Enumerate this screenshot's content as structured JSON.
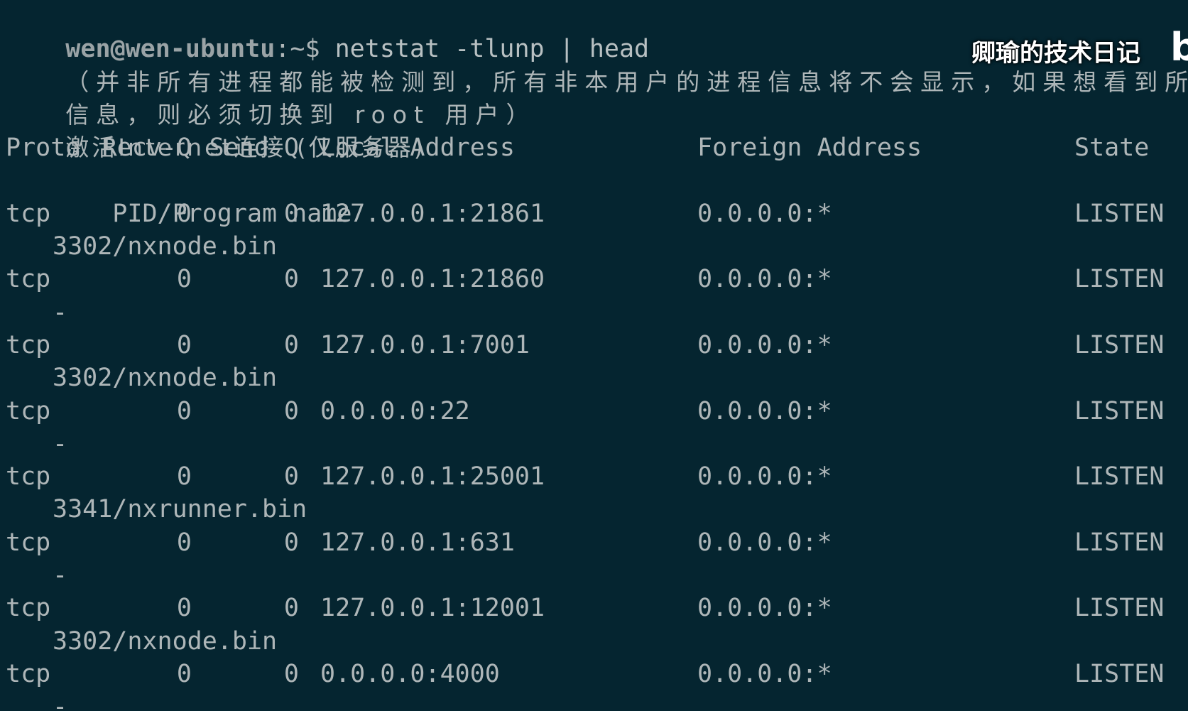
{
  "prompt": {
    "user_host": "wen@wen-ubuntu",
    "path": ":~$",
    "command": "netstat -tlunp | head"
  },
  "notice": {
    "line1": "（并非所有进程都能被检测到，所有非本用户的进程信息将不会显示，如果想看到所有",
    "line2": "信息，则必须切换到 root 用户）"
  },
  "section_title": "激活Internet连接 (仅服务器)",
  "headers": {
    "proto": "Proto",
    "recv_q": "Recv-Q",
    "send_q": "Send-Q",
    "local": "Local Address",
    "foreign": "Foreign Address",
    "state": "State",
    "pid_program": "PID/Program name"
  },
  "rows": [
    {
      "proto": "tcp",
      "recv_q": "0",
      "send_q": "0",
      "local": "127.0.0.1:21861",
      "foreign": "0.0.0.0:*",
      "state": "LISTEN",
      "pid_program": "3302/nxnode.bin"
    },
    {
      "proto": "tcp",
      "recv_q": "0",
      "send_q": "0",
      "local": "127.0.0.1:21860",
      "foreign": "0.0.0.0:*",
      "state": "LISTEN",
      "pid_program": "-"
    },
    {
      "proto": "tcp",
      "recv_q": "0",
      "send_q": "0",
      "local": "127.0.0.1:7001",
      "foreign": "0.0.0.0:*",
      "state": "LISTEN",
      "pid_program": "3302/nxnode.bin"
    },
    {
      "proto": "tcp",
      "recv_q": "0",
      "send_q": "0",
      "local": "0.0.0.0:22",
      "foreign": "0.0.0.0:*",
      "state": "LISTEN",
      "pid_program": "-"
    },
    {
      "proto": "tcp",
      "recv_q": "0",
      "send_q": "0",
      "local": "127.0.0.1:25001",
      "foreign": "0.0.0.0:*",
      "state": "LISTEN",
      "pid_program": "3341/nxrunner.bin"
    },
    {
      "proto": "tcp",
      "recv_q": "0",
      "send_q": "0",
      "local": "127.0.0.1:631",
      "foreign": "0.0.0.0:*",
      "state": "LISTEN",
      "pid_program": "-"
    },
    {
      "proto": "tcp",
      "recv_q": "0",
      "send_q": "0",
      "local": "127.0.0.1:12001",
      "foreign": "0.0.0.0:*",
      "state": "LISTEN",
      "pid_program": "3302/nxnode.bin"
    },
    {
      "proto": "tcp",
      "recv_q": "0",
      "send_q": "0",
      "local": "0.0.0.0:4000",
      "foreign": "0.0.0.0:*",
      "state": "LISTEN",
      "pid_program": "-"
    }
  ],
  "watermark": {
    "text": "卿瑜的技术日记"
  },
  "colors": {
    "background": "#052530",
    "foreground": "#aeb6b8"
  }
}
